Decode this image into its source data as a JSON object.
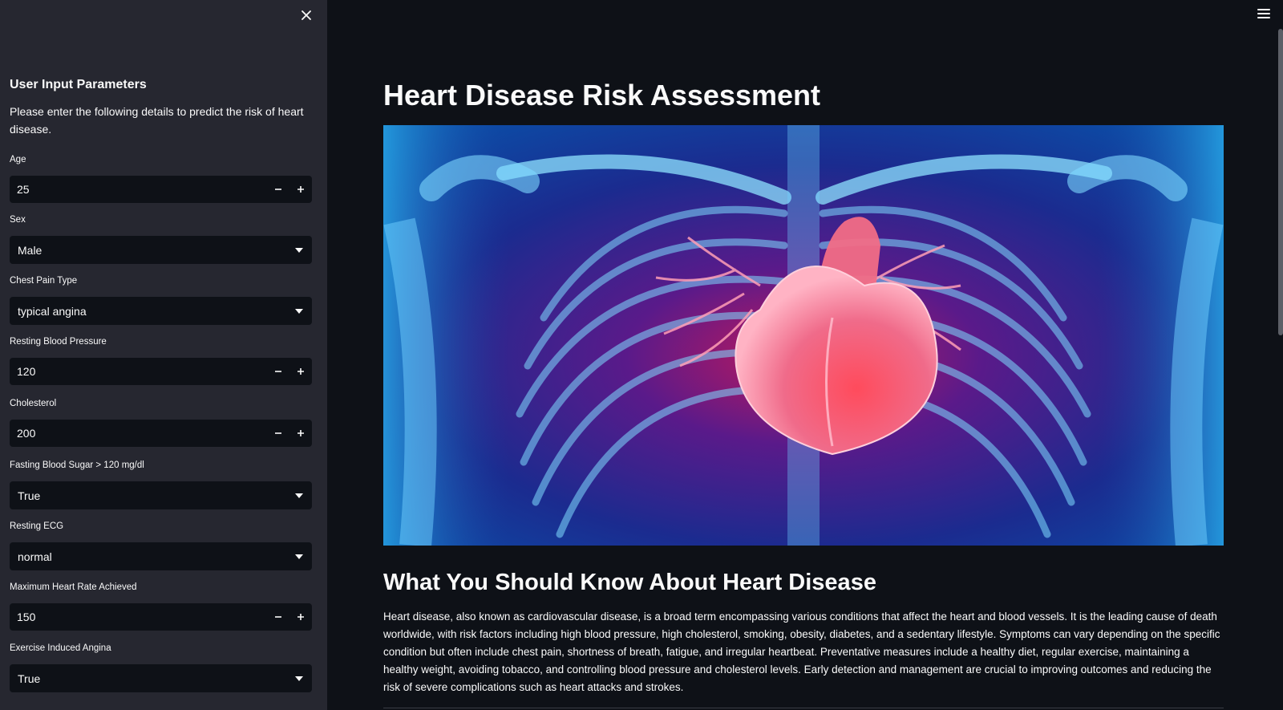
{
  "sidebar": {
    "title": "User Input Parameters",
    "description": "Please enter the following details to predict the risk of heart disease.",
    "fields": {
      "age": {
        "label": "Age",
        "value": "25"
      },
      "sex": {
        "label": "Sex",
        "value": "Male"
      },
      "chest_pain": {
        "label": "Chest Pain Type",
        "value": "typical angina"
      },
      "resting_bp": {
        "label": "Resting Blood Pressure",
        "value": "120"
      },
      "cholesterol": {
        "label": "Cholesterol",
        "value": "200"
      },
      "fasting_bs": {
        "label": "Fasting Blood Sugar > 120 mg/dl",
        "value": "True"
      },
      "resting_ecg": {
        "label": "Resting ECG",
        "value": "normal"
      },
      "max_hr": {
        "label": "Maximum Heart Rate Achieved",
        "value": "150"
      },
      "exercise_angina": {
        "label": "Exercise Induced Angina",
        "value": "True"
      }
    },
    "icons": {
      "close": "close-icon",
      "decrement": "minus-icon",
      "increment": "plus-icon",
      "dropdown": "chevron-down-icon"
    }
  },
  "main": {
    "title": "Heart Disease Risk Assessment",
    "section_title": "What You Should Know About Heart Disease",
    "body": "Heart disease, also known as cardiovascular disease, is a broad term encompassing various conditions that affect the heart and blood vessels. It is the leading cause of death worldwide, with risk factors including high blood pressure, high cholesterol, smoking, obesity, diabetes, and a sedentary lifestyle. Symptoms can vary depending on the specific condition but often include chest pain, shortness of breath, fatigue, and irregular heartbeat. Preventative measures include a healthy diet, regular exercise, maintaining a healthy weight, avoiding tobacco, and controlling blood pressure and cholesterol levels. Early detection and management are crucial to improving outcomes and reducing the risk of severe complications such as heart attacks and strokes.",
    "icons": {
      "menu": "hamburger-menu-icon"
    }
  },
  "colors": {
    "app_background": "#0e1117",
    "sidebar_background": "#262730",
    "text": "#fafafa",
    "heart": "#ff4b6e",
    "xray_blue": "#39c3f0"
  }
}
